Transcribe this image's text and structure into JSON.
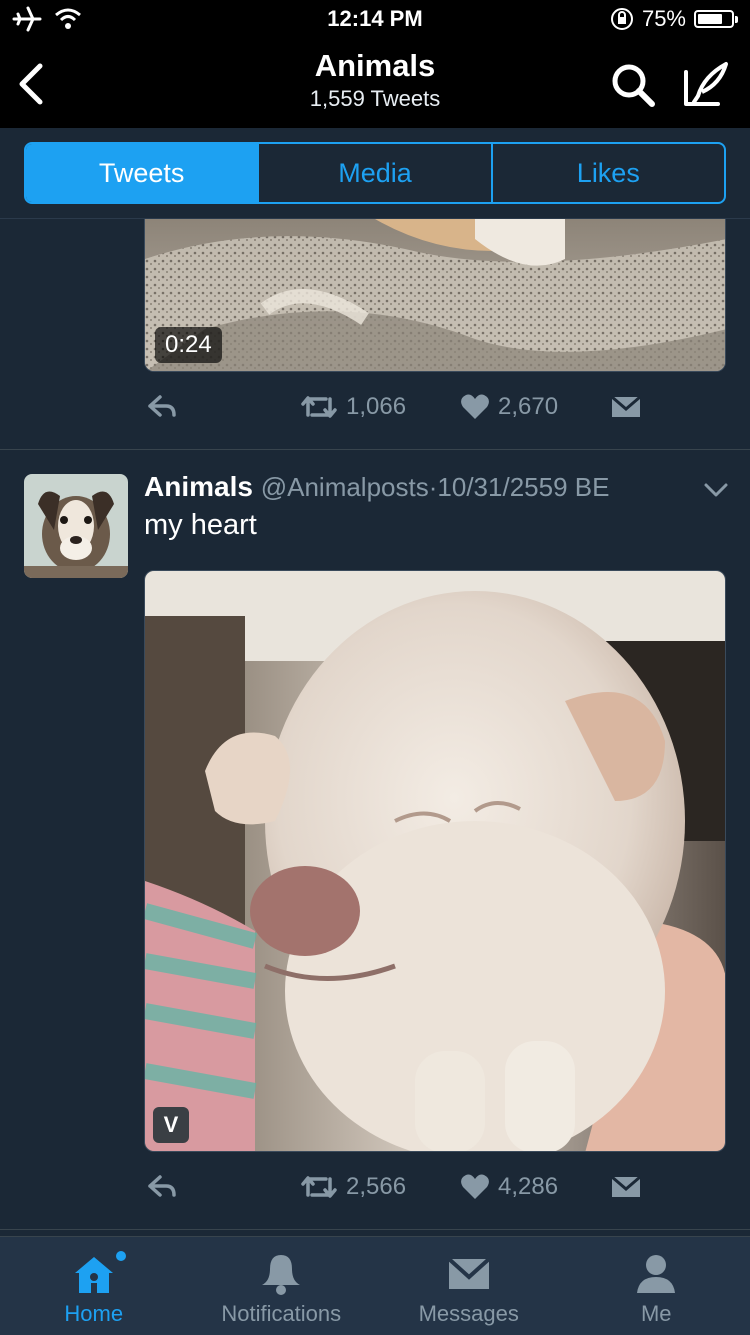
{
  "status_bar": {
    "time": "12:14 PM",
    "battery_percent": "75%",
    "battery_level": 0.75
  },
  "header": {
    "title": "Animals",
    "subtitle": "1,559 Tweets"
  },
  "tabs": [
    {
      "label": "Tweets",
      "active": true
    },
    {
      "label": "Media",
      "active": false
    },
    {
      "label": "Likes",
      "active": false
    }
  ],
  "tweet1": {
    "video_duration": "0:24",
    "retweets": "1,066",
    "likes": "2,670"
  },
  "tweet2": {
    "name": "Animals",
    "handle": "@Animalposts",
    "separator": "·",
    "date": "10/31/2559 BE",
    "text": "my heart",
    "vine_badge": "V",
    "retweets": "2,566",
    "likes": "4,286"
  },
  "tab_bar": [
    {
      "label": "Home",
      "icon": "home-icon",
      "active": true
    },
    {
      "label": "Notifications",
      "icon": "bell-icon",
      "active": false
    },
    {
      "label": "Messages",
      "icon": "envelope-icon",
      "active": false
    },
    {
      "label": "Me",
      "icon": "person-icon",
      "active": false
    }
  ],
  "colors": {
    "accent": "#1da1f2",
    "background": "#1b2836",
    "tab_bar": "#243447",
    "muted_text": "#8899a6"
  }
}
